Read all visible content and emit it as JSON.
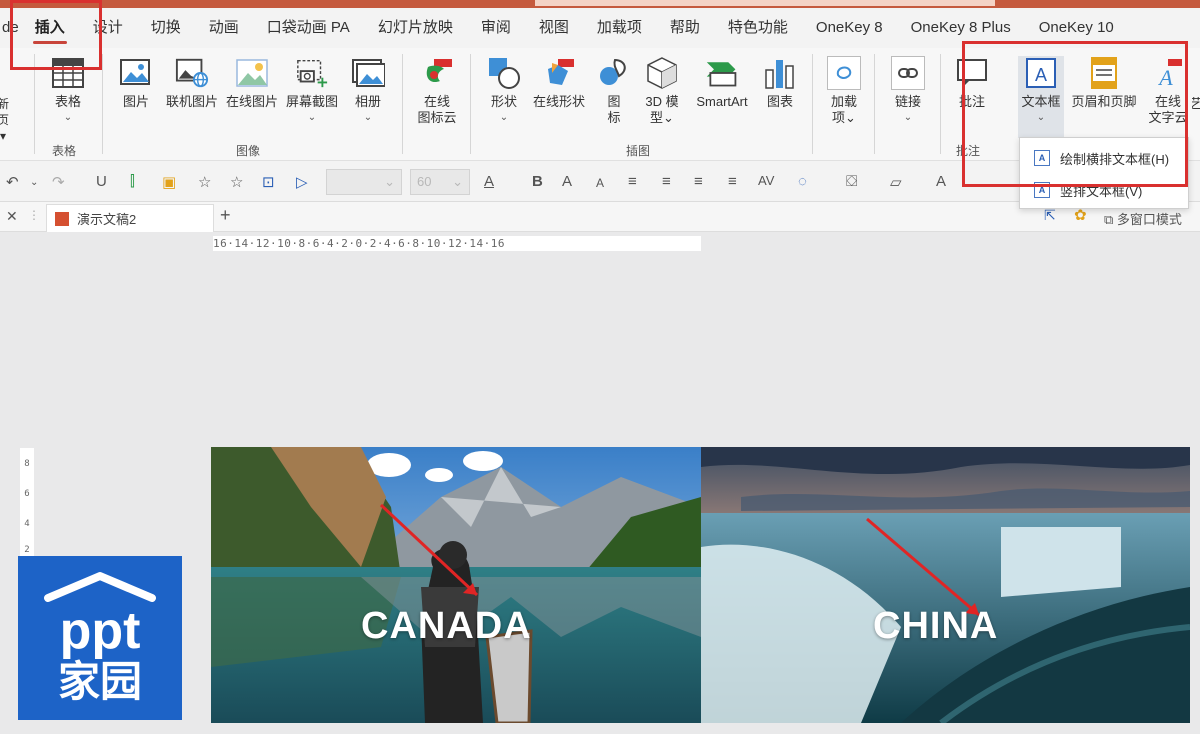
{
  "tabs": [
    "de",
    "插入",
    "设计",
    "切换",
    "动画",
    "口袋动画 PA",
    "幻灯片放映",
    "审阅",
    "视图",
    "加载项",
    "帮助",
    "特色功能",
    "OneKey 8",
    "OneKey 8 Plus",
    "OneKey 10"
  ],
  "ribbon": {
    "new_slide_label": "新\n页",
    "table_label": "表格",
    "picture_label": "图片",
    "online_picture_label": "联机图片",
    "online_pic2_label": "在线图片",
    "screenshot_label": "屏幕截图",
    "album_label": "相册",
    "online_icon_label": "在线\n图标云",
    "shape_label": "形状",
    "online_shape_label": "在线形状",
    "icon_label": "图\n标",
    "model3d_label": "3D 模\n型",
    "smartart_label": "SmartArt",
    "chart_label": "图表",
    "addin_label": "加载\n项",
    "link_label": "链接",
    "comment_label": "批注",
    "textbox_label": "文本框",
    "header_footer_label": "页眉和页脚",
    "online_text_label": "在线\n文字云",
    "more_label": "艺",
    "group_table": "表格",
    "group_image": "图像",
    "group_illustration": "插图",
    "group_comment": "批注"
  },
  "toolbar2": {
    "font_size": "60",
    "items": [
      "↶",
      "↷",
      "U",
      "A",
      "B",
      "A",
      "A",
      "≡",
      "≡",
      "≡",
      "≡",
      "AV",
      "◌",
      "A"
    ]
  },
  "doc": {
    "tab_title": "演示文稿2",
    "multi_window": "多窗口模式"
  },
  "ruler": "16·14·12·10·8·6·4·2·0·2·4·6·8·10·12·14·16",
  "slide": {
    "label_left": "CANADA",
    "label_right": "CHINA"
  },
  "dropdown": {
    "item1": "绘制横排文本框(H)",
    "item2": "竖排文本框(V)"
  },
  "logo": {
    "line1": "ppt",
    "line2": "家园"
  },
  "colors": {
    "accent_red": "#d9302f",
    "logo_blue": "#1d63c7"
  }
}
